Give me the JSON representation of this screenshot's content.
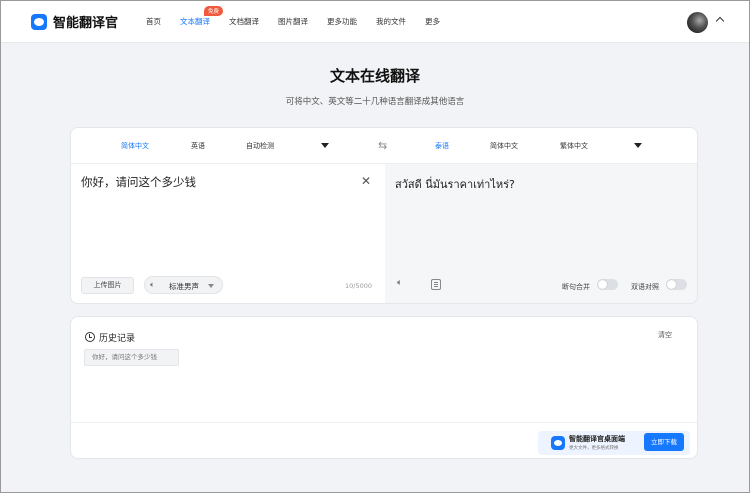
{
  "brand": {
    "name": "智能翻译官"
  },
  "nav": {
    "items": [
      {
        "label": "首页"
      },
      {
        "label": "文本翻译",
        "badge": "免费"
      },
      {
        "label": "文档翻译"
      },
      {
        "label": "图片翻译"
      },
      {
        "label": "更多功能"
      },
      {
        "label": "我的文件"
      },
      {
        "label": "更多"
      }
    ],
    "active_index": 1
  },
  "hero": {
    "title": "文本在线翻译",
    "subtitle": "可将中文、英文等二十几种语言翻译成其他语言"
  },
  "translator": {
    "source_langs": [
      "简体中文",
      "英语",
      "自动检测"
    ],
    "target_langs": [
      "泰语",
      "简体中文",
      "繁体中文"
    ],
    "swap_icon": "swap-arrows-icon",
    "source_text": "你好，请问这个多少钱",
    "target_text": "สวัสดี นี่มันราคาเท่าไหร่?",
    "upload_label": "上传图片",
    "voice_label": "标准男声",
    "char_count": "10",
    "char_limit": "/5000",
    "toggle_sentence": "断句合并",
    "toggle_bilingual": "双语对照"
  },
  "history": {
    "title": "历史记录",
    "clear_label": "清空",
    "items": [
      {
        "text": "你好，请问这个多少钱"
      }
    ]
  },
  "promo": {
    "title": "智能翻译官桌面端",
    "subtitle": "更大文件，更多格式转换",
    "button": "立即下载"
  },
  "colors": {
    "accent": "#1677ff",
    "badge": "#f25a3e",
    "background": "#f1f3f6"
  }
}
